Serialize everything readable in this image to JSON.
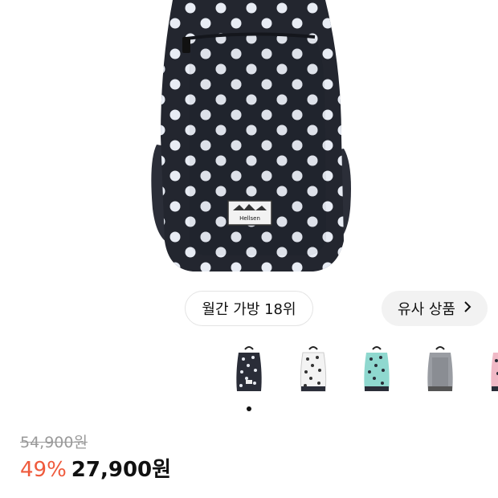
{
  "product": {
    "image_alt": "backpack-image",
    "brand_patch": "Hellsen"
  },
  "rank_badge": {
    "label": "월간 가방 18위"
  },
  "similar_button": {
    "label": "유사 상품",
    "icon": "chevron-right-icon"
  },
  "variants": {
    "items": [
      {
        "color": "navy-polka-dot",
        "selected": true
      },
      {
        "color": "white-polka-dot",
        "selected": false
      },
      {
        "color": "mint-polka-dot",
        "selected": false
      },
      {
        "color": "gray",
        "selected": false
      },
      {
        "color": "pink-polka-dot",
        "selected": false
      }
    ]
  },
  "pricing": {
    "original_price": "54,900원",
    "discount_rate": "49%",
    "sale_price": "27,900원"
  },
  "colors": {
    "discount": "#ef5a3c",
    "pill_border": "#e4e4e4",
    "pill_bg": "#f2f2f2"
  }
}
